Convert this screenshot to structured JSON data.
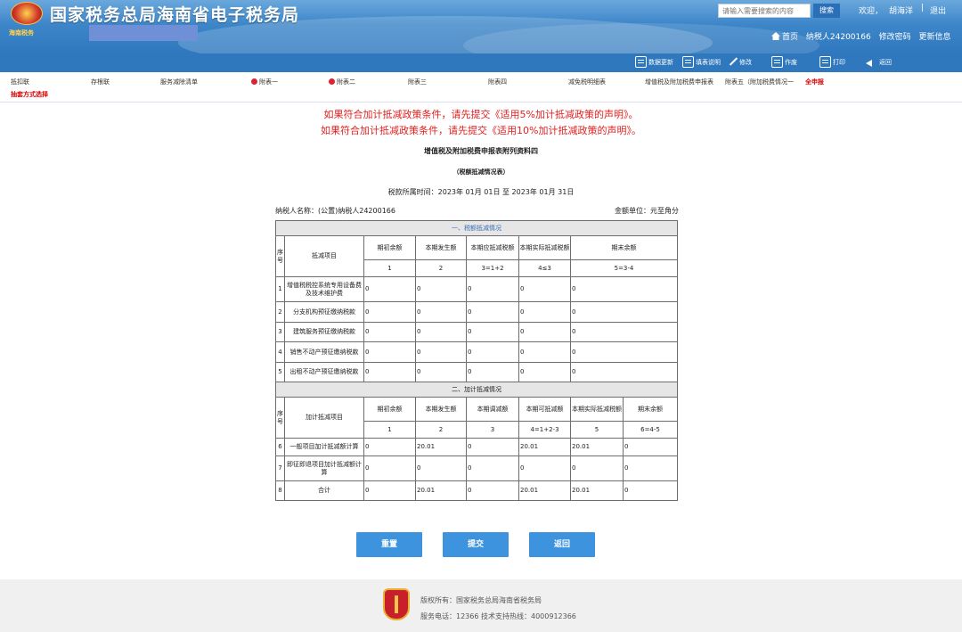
{
  "header": {
    "site_title": "国家税务总局海南省电子税务局",
    "brand_text": "海南税务",
    "search_placeholder": "请输入需要搜索的内容",
    "search_button": "搜索",
    "welcome": "欢迎，",
    "user_name": "胡海洋",
    "separator": "|",
    "logout": "退出",
    "home": "首页",
    "taxpayer": "纳税人24200166",
    "change_password": "修改密码",
    "update_info": "更新信息"
  },
  "toolbar": {
    "data_update": "数据更新",
    "fill_instructions": "填表说明",
    "modify": "修改",
    "void": "作废",
    "print": "打印",
    "back": "返回"
  },
  "tabs": [
    "抵扣联",
    "存根联",
    "服务减除清单",
    "附表一",
    "附表二",
    "附表三",
    "附表四",
    "减免税明细表",
    "增值税及附加税费申报表",
    "附表五（附加税费情况一",
    "全申报"
  ],
  "tab_method": "抽套方式选择",
  "notices": [
    "如果符合加计抵减政策条件，请先提交《适用5%加计抵减政策的声明》。",
    "如果符合加计抵减政策条件，请先提交《适用10%加计抵减政策的声明》。"
  ],
  "form": {
    "title": "增值税及附加税费申报表附列资料四",
    "subtitle": "（税额抵减情况表）",
    "period": "税款所属时间：2023年 01月 01日 至 2023年 01月 31日",
    "taxpayer": "纳税人名称：(公置)纳税人24200166",
    "unit": "金额单位：元至角分"
  },
  "section1": {
    "title": "一、税额抵减情况",
    "seq_header": "序号",
    "item_header": "抵减项目",
    "col_headers": [
      "期初余额",
      "本期发生额",
      "本期应抵减税额",
      "本期实际抵减税额",
      "期末余额"
    ],
    "formulas": [
      "1",
      "2",
      "3=1+2",
      "4≤3",
      "5=3-4"
    ],
    "rows": [
      {
        "seq": "1",
        "item": "增值税税控系统专用设备费及技术维护费",
        "values": [
          "0",
          "0",
          "0",
          "0",
          "0"
        ]
      },
      {
        "seq": "2",
        "item": "分支机构预征缴纳税款",
        "values": [
          "0",
          "0",
          "0",
          "0",
          "0"
        ]
      },
      {
        "seq": "3",
        "item": "建筑服务预征缴纳税款",
        "values": [
          "0",
          "0",
          "0",
          "0",
          "0"
        ]
      },
      {
        "seq": "4",
        "item": "销售不动产预征缴纳税款",
        "values": [
          "0",
          "0",
          "0",
          "0",
          "0"
        ]
      },
      {
        "seq": "5",
        "item": "出租不动产预征缴纳税款",
        "values": [
          "0",
          "0",
          "0",
          "0",
          "0"
        ]
      }
    ]
  },
  "section2": {
    "title": "二、加计抵减情况",
    "seq_header": "序号",
    "item_header": "加计抵减项目",
    "col_headers": [
      "期初余额",
      "本期发生额",
      "本期调减额",
      "本期可抵减额",
      "本期实际抵减税额",
      "期末余额"
    ],
    "formulas": [
      "1",
      "2",
      "3",
      "4=1+2-3",
      "5",
      "6=4-5"
    ],
    "rows": [
      {
        "seq": "6",
        "item": "一般项目加计抵减额计算",
        "values": [
          "0",
          "20.01",
          "0",
          "20.01",
          "20.01",
          "0"
        ]
      },
      {
        "seq": "7",
        "item": "即征即退项目加计抵减额计算",
        "values": [
          "0",
          "0",
          "0",
          "0",
          "0",
          "0"
        ]
      },
      {
        "seq": "8",
        "item": "合计",
        "values": [
          "0",
          "20.01",
          "0",
          "20.01",
          "20.01",
          "0"
        ]
      }
    ]
  },
  "buttons": {
    "reset": "重置",
    "submit": "提交",
    "return": "返回"
  },
  "footer": {
    "copyright": "版权所有：国家税务总局海南省税务局",
    "phone": "服务电话：12366 技术支持热线：4000912366"
  }
}
